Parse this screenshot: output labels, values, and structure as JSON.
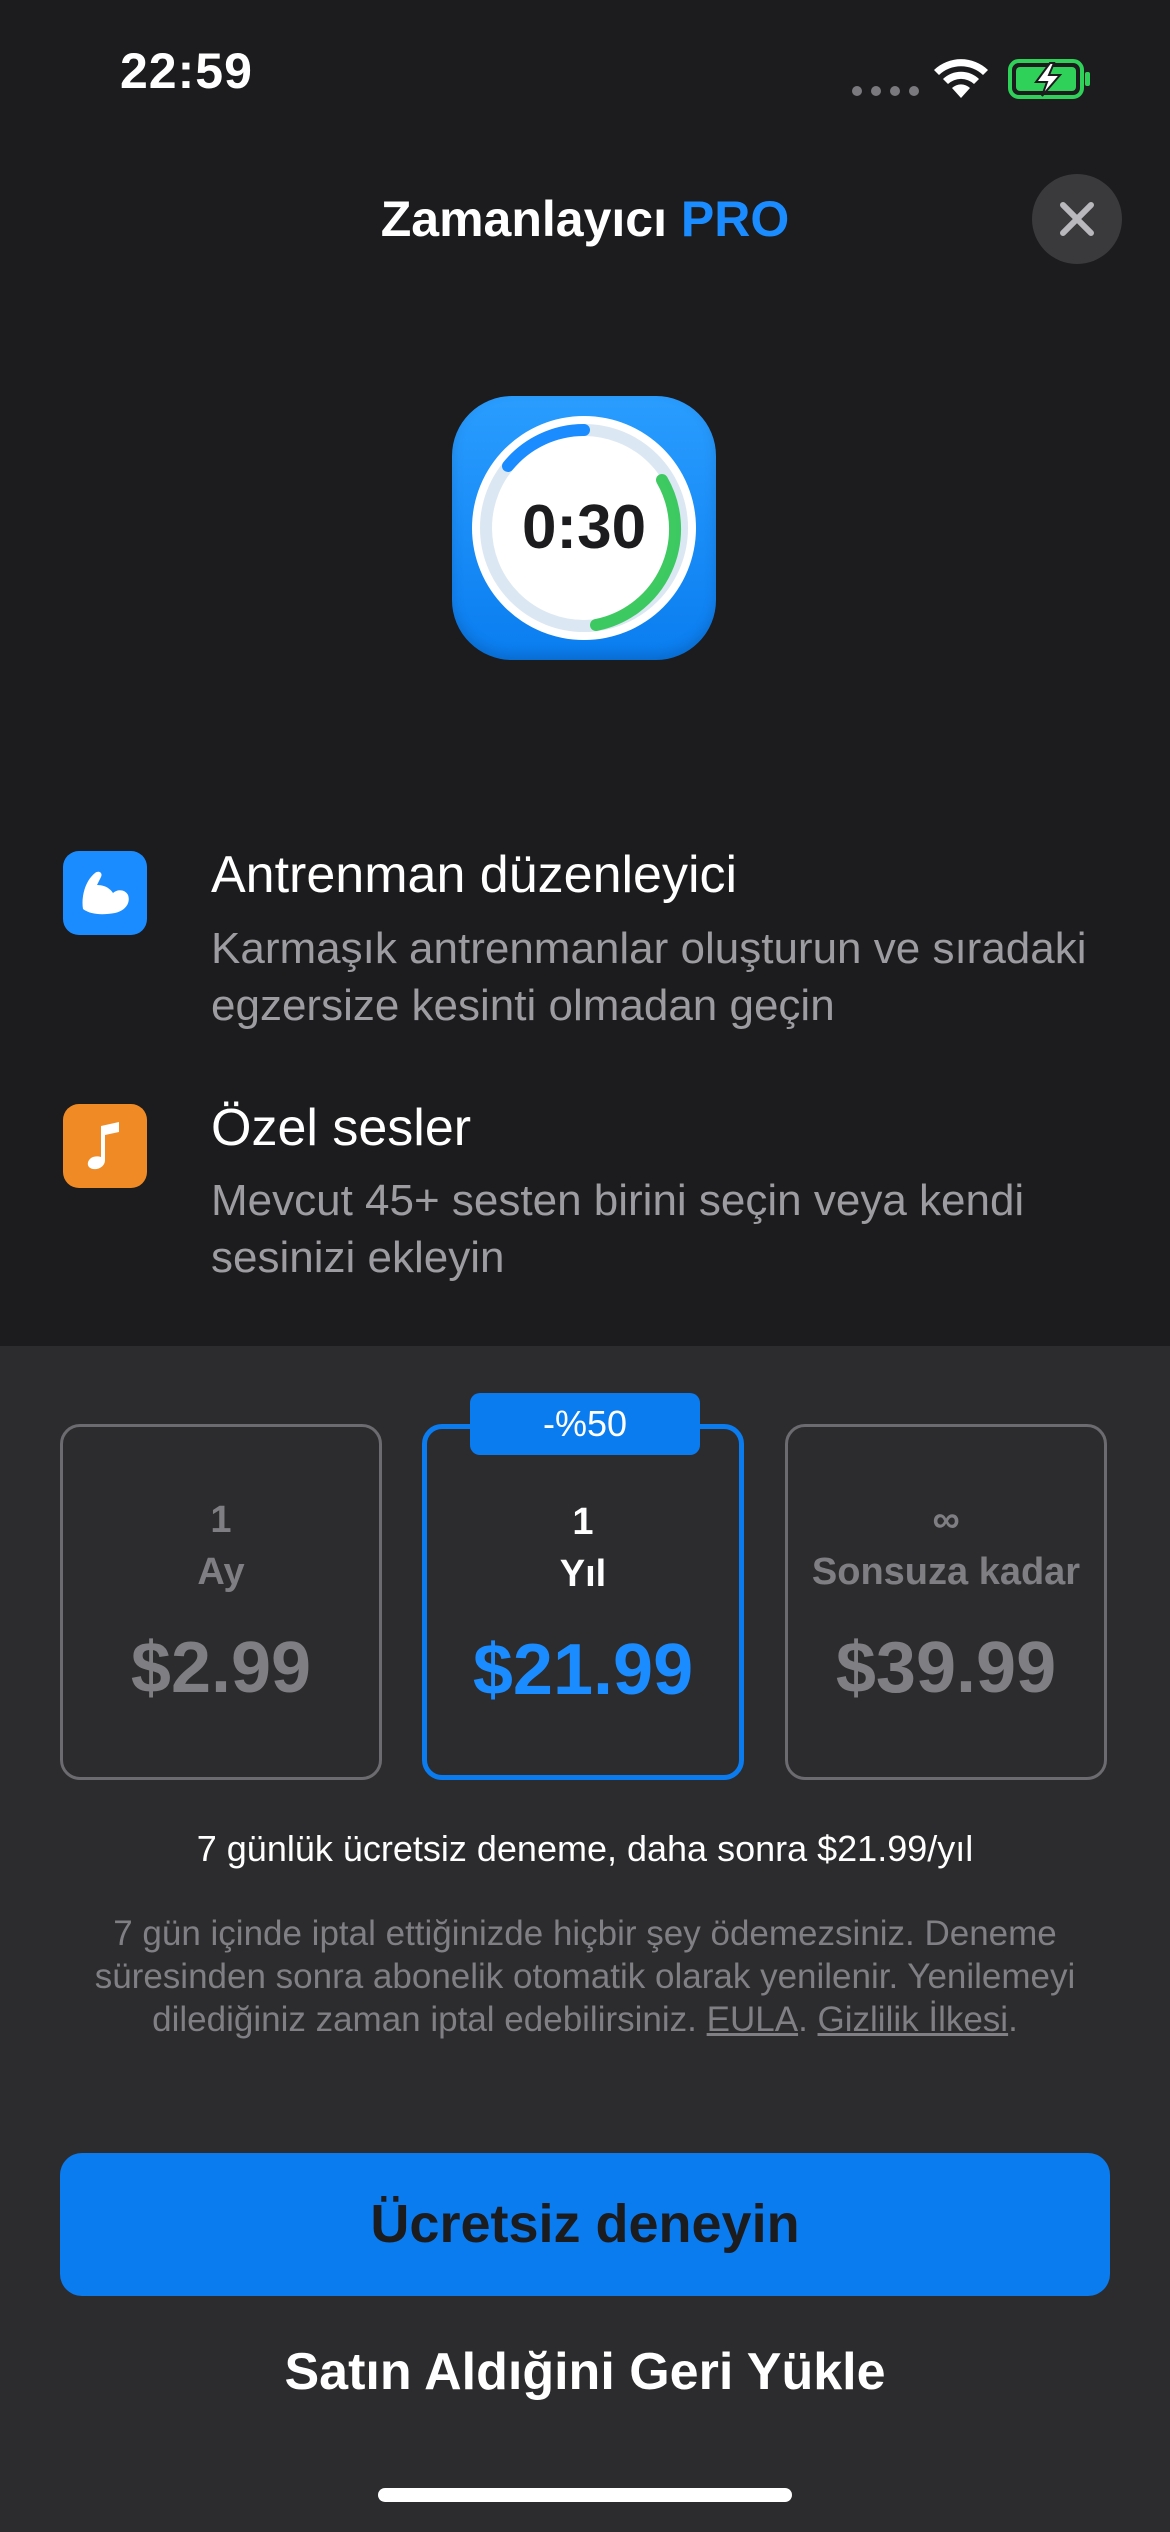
{
  "status_bar": {
    "time": "22:59"
  },
  "header": {
    "title": "Zamanlayıcı",
    "title_accent": "PRO"
  },
  "app_icon": {
    "timer_text": "0:30"
  },
  "features": [
    {
      "icon": "flexed-biceps-icon",
      "icon_color": "#1a8cff",
      "title": "Antrenman düzenleyici",
      "description": "Karmaşık antrenmanlar oluşturun ve sıradaki egzersize kesinti olmadan geçin"
    },
    {
      "icon": "music-note-icon",
      "icon_color": "#f08a24",
      "title": "Özel sesler",
      "description": "Mevcut 45+ sesten birini seçin veya kendi sesinizi ekleyin"
    }
  ],
  "plans": [
    {
      "count": "1",
      "unit": "Ay",
      "price": "$2.99",
      "selected": false
    },
    {
      "count": "1",
      "unit": "Yıl",
      "price": "$21.99",
      "selected": true,
      "badge": "-%50"
    },
    {
      "count": "∞",
      "unit": "Sonsuza kadar",
      "price": "$39.99",
      "selected": false
    }
  ],
  "trial_text": "7 günlük ücretsiz deneme, daha sonra $21.99/yıl",
  "legal": {
    "text": "7 gün içinde iptal ettiğinizde hiçbir şey ödemezsiniz. Deneme süresinden sonra abonelik otomatik olarak yenilenir. Yenilemeyi dilediğiniz zaman iptal edebilirsiniz.",
    "eula_label": "EULA",
    "separator": ". ",
    "privacy_label": "Gizlilik İlkesi",
    "end": "."
  },
  "cta_label": "Ücretsiz deneyin",
  "restore_label": "Satın Aldığini Geri Yükle",
  "colors": {
    "accent": "#0a7cf0",
    "background_top": "#1c1c1e",
    "background_bottom": "#2c2c2e"
  }
}
